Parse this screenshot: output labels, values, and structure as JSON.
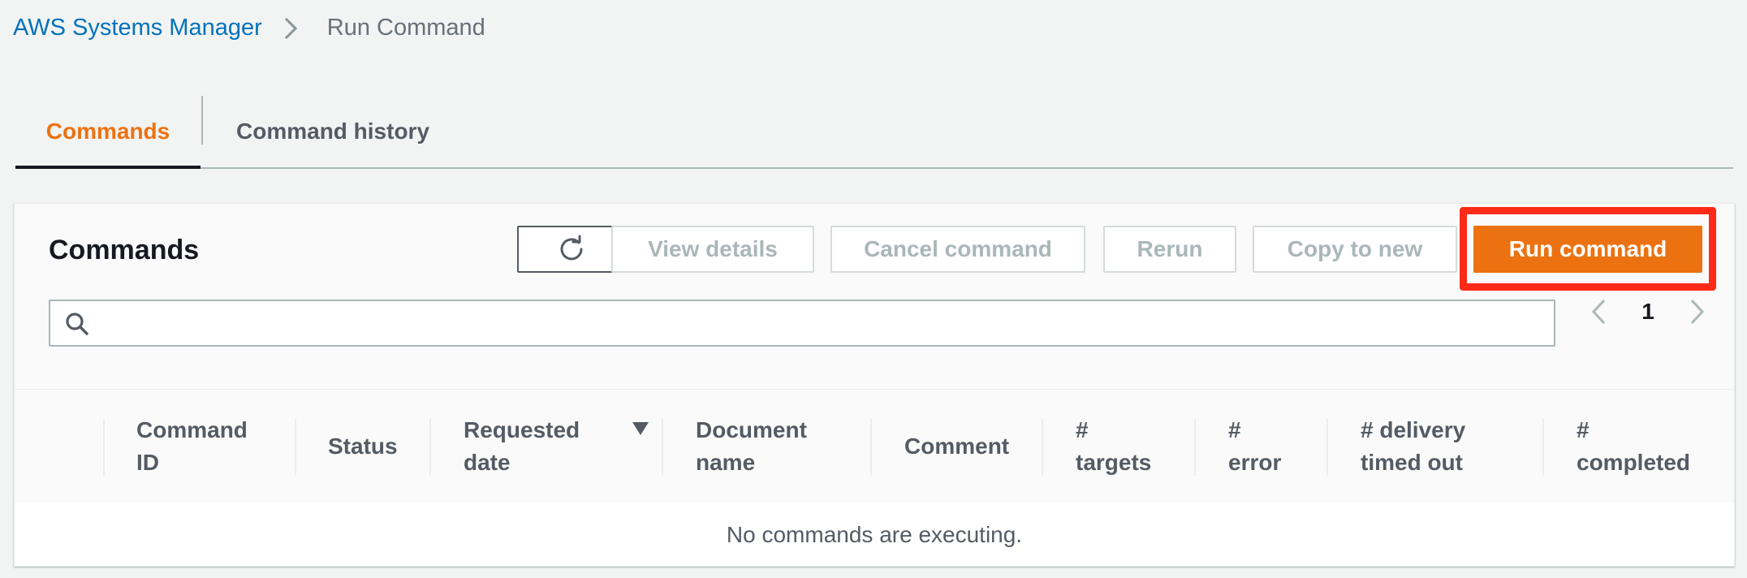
{
  "breadcrumb": {
    "service": "AWS Systems Manager",
    "current": "Run Command"
  },
  "tabs": [
    {
      "label": "Commands",
      "active": true
    },
    {
      "label": "Command history",
      "active": false
    }
  ],
  "panel": {
    "title": "Commands",
    "buttons": {
      "view_details": "View details",
      "cancel_command": "Cancel command",
      "rerun": "Rerun",
      "copy_to_new": "Copy to new",
      "run_command": "Run command"
    },
    "search": {
      "value": "",
      "placeholder": ""
    },
    "pagination": {
      "page": "1"
    }
  },
  "table": {
    "columns": [
      {
        "line1": "Command",
        "line2": "ID"
      },
      {
        "line1": "Status",
        "line2": ""
      },
      {
        "line1": "Requested",
        "line2": "date"
      },
      {
        "line1": "Document",
        "line2": "name"
      },
      {
        "line1": "Comment",
        "line2": ""
      },
      {
        "line1": "#",
        "line2": "targets"
      },
      {
        "line1": "#",
        "line2": "error"
      },
      {
        "line1": "# delivery",
        "line2": "timed out"
      },
      {
        "line1": "#",
        "line2": "completed"
      }
    ],
    "empty_message": "No commands are executing."
  },
  "colors": {
    "accent": "#ec7211",
    "link": "#0073bb",
    "highlight": "#ff2a17"
  },
  "icons": [
    "chevron-right-icon",
    "refresh-icon",
    "search-icon",
    "chevron-left-icon",
    "sort-descending-icon"
  ]
}
